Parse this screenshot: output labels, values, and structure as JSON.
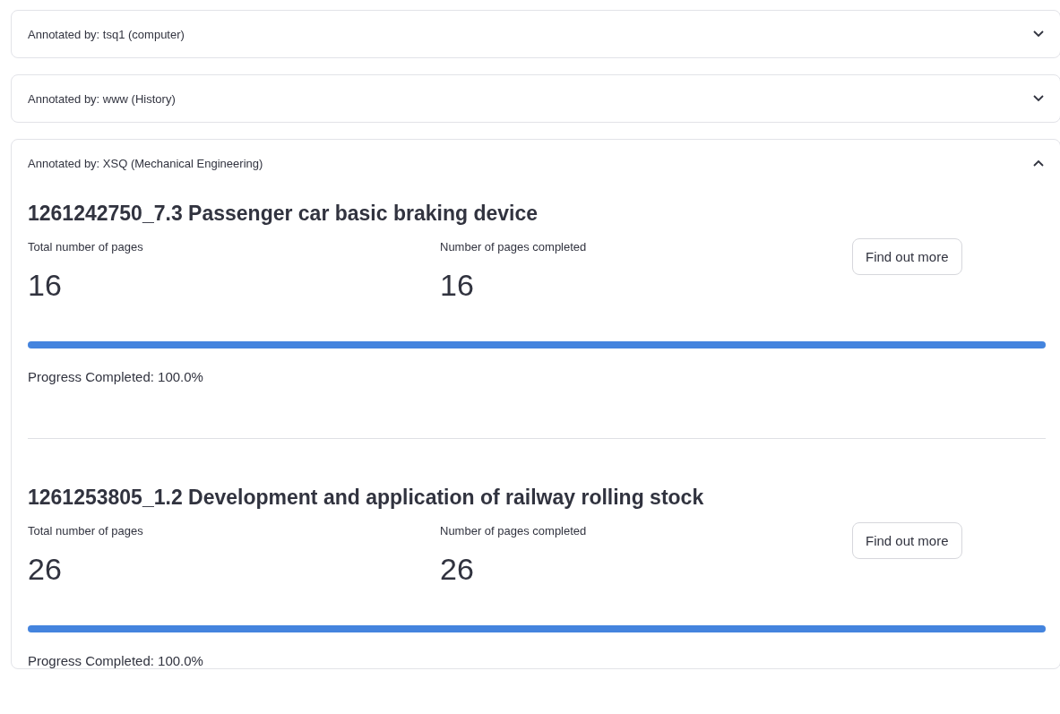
{
  "expanders": [
    {
      "header": "Annotated by: tsq1 (computer)",
      "expanded": false
    },
    {
      "header": "Annotated by: www (History)",
      "expanded": false
    },
    {
      "header": "Annotated by: XSQ (Mechanical Engineering)",
      "expanded": true,
      "documents": [
        {
          "title": "1261242750_7.3 Passenger car basic braking device",
          "total_label": "Total number of pages",
          "total": "16",
          "completed_label": "Number of pages completed",
          "completed": "16",
          "button": "Find out more",
          "level": 1.0,
          "progress_text": "Progress Completed: 100.0%"
        },
        {
          "title": "1261253805_1.2 Development and application of railway rolling stock",
          "total_label": "Total number of pages",
          "total": "26",
          "completed_label": "Number of pages completed",
          "completed": "26",
          "button": "Find out more",
          "level": 1.0,
          "progress_text": "Progress Completed: 100.0%"
        }
      ]
    }
  ]
}
